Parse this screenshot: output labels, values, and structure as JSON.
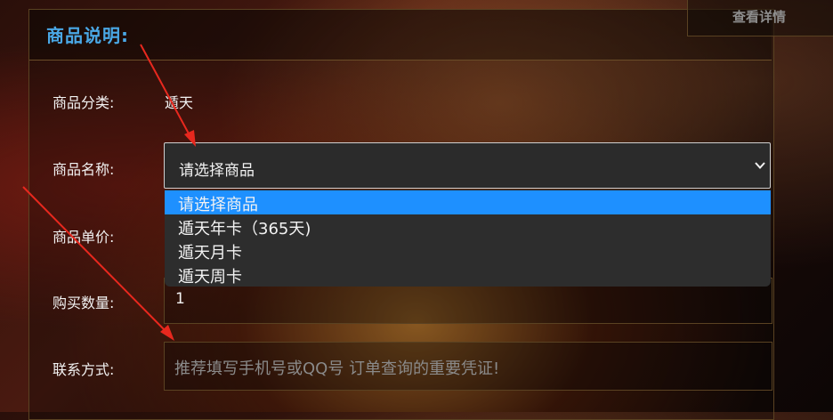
{
  "header": {
    "title": "商品说明:",
    "detail_button": "查看详情"
  },
  "form": {
    "category": {
      "label": "商品分类:",
      "value": "遁天"
    },
    "product": {
      "label": "商品名称:",
      "selected": "请选择商品",
      "options": [
        "请选择商品",
        "遁天年卡（365天)",
        "遁天月卡",
        "遁天周卡"
      ]
    },
    "unit_price": {
      "label": "商品单价:"
    },
    "quantity": {
      "label": "购买数量:",
      "value": "1"
    },
    "contact": {
      "label": "联系方式:",
      "placeholder": "推荐填写手机号或QQ号 订单查询的重要凭证!"
    }
  },
  "colors": {
    "title": "#4aa8e6",
    "highlight": "#1e90ff",
    "arrow": "#e8281e",
    "border": "#5a4222"
  }
}
